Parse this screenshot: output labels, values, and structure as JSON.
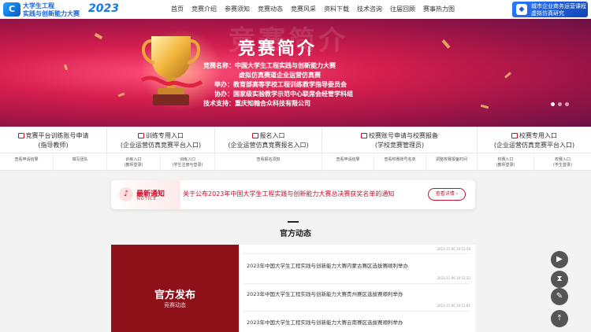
{
  "header": {
    "logo_line1": "大学生工程",
    "logo_line2": "实践与创新能力大赛",
    "year": "2023",
    "nav": [
      "首页",
      "竞赛介绍",
      "参赛须知",
      "竞赛动态",
      "竞赛风采",
      "资料下载",
      "技术咨询",
      "往届回顾",
      "赛事热力图"
    ],
    "brand_line1": "城市企业商务运营课程",
    "brand_line2": "虚拟仿真研究"
  },
  "banner": {
    "bg_text": "竞赛简介",
    "title": "竞赛简介",
    "info": [
      "竞赛名称：中国大学生工程实践与创新能力大赛",
      "虚拟仿真赛道企业运营仿真赛",
      "举办：教育部高等学校工程训练教学指导委员会",
      "协办：国家级实验教学示范中心联席会经管学科组",
      "技术支持：重庆知翰合众科技有限公司"
    ],
    "slide_count": 3,
    "active_slide": 1
  },
  "entries": [
    {
      "title": "竞赛平台训练账号申请",
      "sub": "(指导教师)"
    },
    {
      "title": "训练专用入口",
      "sub": "(企业运营仿真竞赛平台入口)"
    },
    {
      "title": "报名入口",
      "sub": "(企业运营仿真竞赛报名入口)"
    },
    {
      "title": "校赛账号申请与校赛报备",
      "sub": "(学校竞赛管理员)"
    },
    {
      "title": "校赛专用入口",
      "sub": "(企业运营仿真竞赛平台入口)"
    }
  ],
  "subs": [
    {
      "l1": "查看申请结果",
      "l2": ""
    },
    {
      "l1": "填写团队",
      "l2": ""
    },
    {
      "l1": "训练入口",
      "l2": "(教师登录)"
    },
    {
      "l1": "训练入口",
      "l2": "(学生注册与登录)"
    },
    {
      "l1": "查看报名须知",
      "l2": ""
    },
    {
      "l1": "查看申请结果",
      "l2": ""
    },
    {
      "l1": "查看校赛账号名单",
      "l2": ""
    },
    {
      "l1": "调整校赛报备时间",
      "l2": ""
    },
    {
      "l1": "校赛入口",
      "l2": "(教师登录)"
    },
    {
      "l1": "校赛入口",
      "l2": "(学生登录)"
    }
  ],
  "notice": {
    "label": "最新通知",
    "label_en": "NOTICE",
    "text": "关于公布2023年中国大学生工程实践与创新能力大赛总决赛获奖名单的通知",
    "button": "查看详情 ›"
  },
  "section": {
    "title": "官方动态"
  },
  "news": {
    "panel_title": "官方发布",
    "panel_sub": "竞赛动态",
    "items": [
      {
        "title": "",
        "date": "2023-11-06 10:53:59"
      },
      {
        "title": "2023年中国大学生工程实践与创新能力大赛内蒙古赛区选拔赛顺利举办",
        "date": "2023-11-06 10:53:22"
      },
      {
        "title": "2023年中国大学生工程实践与创新能力大赛贵州赛区选拔赛顺利举办",
        "date": "2023-11-06 10:51:01"
      },
      {
        "title": "2023年中国大学生工程实践与创新能力大赛云南赛区选拔赛顺利举办",
        "date": ""
      }
    ]
  },
  "side_buttons": [
    "play-icon",
    "hourglass-icon",
    "edit-icon",
    "top-icon"
  ],
  "colors": {
    "accent": "#c8102e",
    "panel": "#8e1019",
    "nav_blue": "#1a63d8"
  }
}
